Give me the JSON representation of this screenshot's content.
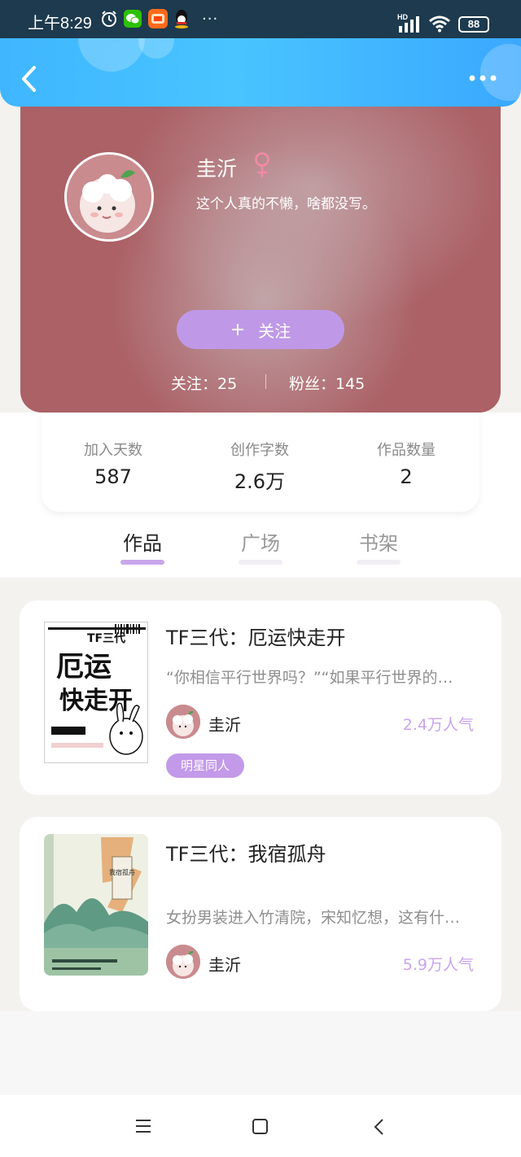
{
  "status_bar": {
    "time": "上午8:29",
    "battery": "88",
    "network": "HD",
    "more": "···"
  },
  "nav": {
    "back_icon": "chevron-left-icon",
    "more_icon": "more-dots-icon"
  },
  "profile": {
    "name": "圭沂",
    "gender": "female",
    "bio": "这个人真的不懒，啥都没写。",
    "follow_label": "关注",
    "follow_plus": "+",
    "following_text": "关注：25",
    "fans_text": "粉丝：145"
  },
  "stats": [
    {
      "label": "加入天数",
      "value": "587"
    },
    {
      "label": "创作字数",
      "value": "2.6万"
    },
    {
      "label": "作品数量",
      "value": "2"
    }
  ],
  "tabs": [
    {
      "label": "作品",
      "active": true
    },
    {
      "label": "广场",
      "active": false
    },
    {
      "label": "书架",
      "active": false
    }
  ],
  "works": [
    {
      "title": "TF三代：厄运快走开",
      "description": "“你相信平行世界吗？”“如果平行世界的…",
      "author": "圭沂",
      "popularity": "2.4万人气",
      "tag": "明星同人",
      "cover_text": [
        "TF三代",
        "厄运",
        "快走开"
      ]
    },
    {
      "title": "TF三代：我宿孤舟",
      "description": "女扮男装进入竹清院，宋知忆想，这有什…",
      "author": "圭沂",
      "popularity": "5.9万人气",
      "tag": "",
      "cover_text": [
        "我宿孤舟"
      ]
    }
  ],
  "colors": {
    "header": "#45bdff",
    "banner": "#ab6166",
    "accent": "#c29ae9",
    "popularity": "#c9a4ec"
  }
}
